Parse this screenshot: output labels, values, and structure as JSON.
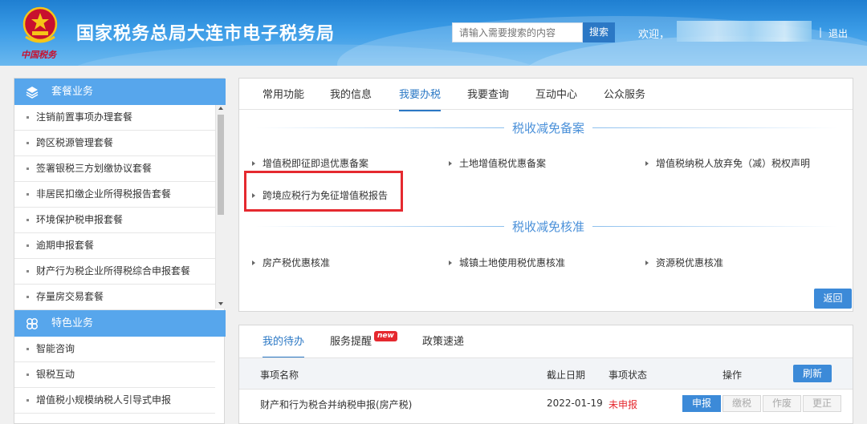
{
  "header": {
    "title": "国家税务总局大连市电子税务局",
    "emblem_sub": "中国税务",
    "search_placeholder": "请输入需要搜索的内容",
    "search_button": "搜索",
    "welcome": "欢迎，",
    "separator": "|",
    "logout": "退出"
  },
  "sidebar": {
    "package_header": "套餐业务",
    "package_items": [
      "注销前置事项办理套餐",
      "跨区税源管理套餐",
      "签署银税三方划缴协议套餐",
      "非居民扣缴企业所得税报告套餐",
      "环境保护税申报套餐",
      "逾期申报套餐",
      "财产行为税企业所得税综合申报套餐",
      "存量房交易套餐"
    ],
    "special_header": "特色业务",
    "special_items": [
      "智能咨询",
      "银税互动",
      "增值税小规模纳税人引导式申报"
    ]
  },
  "main": {
    "tabs": [
      "常用功能",
      "我的信息",
      "我要办税",
      "我要查询",
      "互动中心",
      "公众服务"
    ],
    "active_tab": "我要办税",
    "section1_title": "税收减免备案",
    "section1_items": [
      "增值税即征即退优惠备案",
      "土地增值税优惠备案",
      "增值税纳税人放弃免（减）税权声明",
      "跨境应税行为免征增值税报告"
    ],
    "section2_title": "税收减免核准",
    "section2_items": [
      "房产税优惠核准",
      "城镇土地使用税优惠核准",
      "资源税优惠核准"
    ],
    "back_button": "返回"
  },
  "bottom": {
    "tabs": [
      "我的待办",
      "服务提醒",
      "政策速递"
    ],
    "new_badge": "new",
    "columns": [
      "事项名称",
      "截止日期",
      "事项状态",
      "操作"
    ],
    "refresh_button": "刷新",
    "row": {
      "name": "财产和行为税合并纳税申报(房产税)",
      "deadline": "2022-01-19",
      "status": "未申报",
      "actions": [
        "申报",
        "缴税",
        "作废",
        "更正"
      ]
    }
  },
  "colors": {
    "accent": "#2b78c5",
    "sidebar_header": "#57a6ec",
    "highlight": "#e5292f",
    "status_red": "#e5292f"
  }
}
